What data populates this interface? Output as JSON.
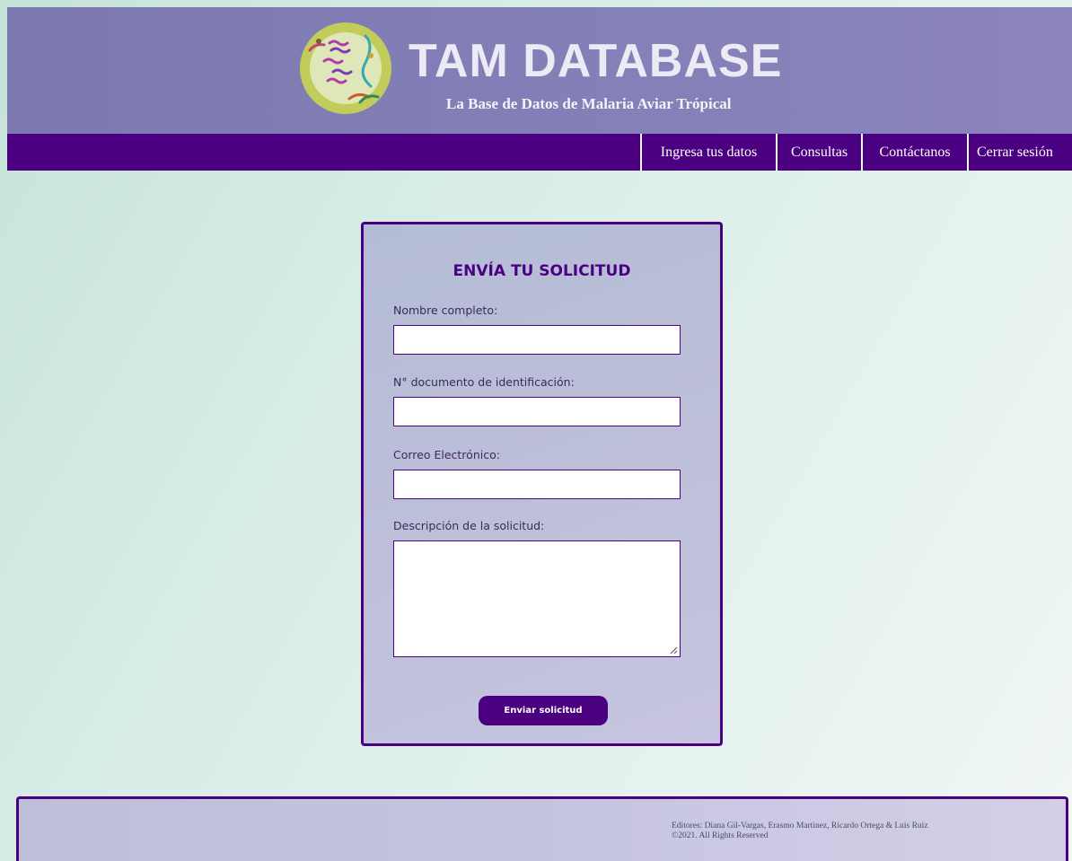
{
  "header": {
    "title": "TAM DATABASE",
    "subtitle": "La Base de Datos de Malaria Aviar Trópical"
  },
  "nav": {
    "items": [
      {
        "label": "Ingresa tus datos"
      },
      {
        "label": "Consultas"
      },
      {
        "label": "Contáctanos"
      },
      {
        "label": "Cerrar sesión"
      }
    ]
  },
  "form": {
    "title": "ENVÍA TU SOLICITUD",
    "fields": {
      "nombre": {
        "label": "Nombre completo:",
        "value": ""
      },
      "documento": {
        "label": "N° documento de identificación:",
        "value": ""
      },
      "correo": {
        "label": "Correo Electrónico:",
        "value": ""
      },
      "descripcion": {
        "label": "Descripción de la solicitud:",
        "value": ""
      }
    },
    "submit_label": "Enviar solicitud"
  },
  "footer": {
    "editors": "Editores: Diana Gil-Vargas, Erasmo Martinez, Ricardo Ortega & Luis Ruiz",
    "copyright": "©2021. All Rights Reserved"
  },
  "colors": {
    "primary": "#4b0082",
    "header_bg": "#8480b8",
    "page_bg": "#dcefea"
  },
  "icons": {
    "logo": "malaria-parasite-logo-icon",
    "resize": "resize-grip-icon"
  }
}
